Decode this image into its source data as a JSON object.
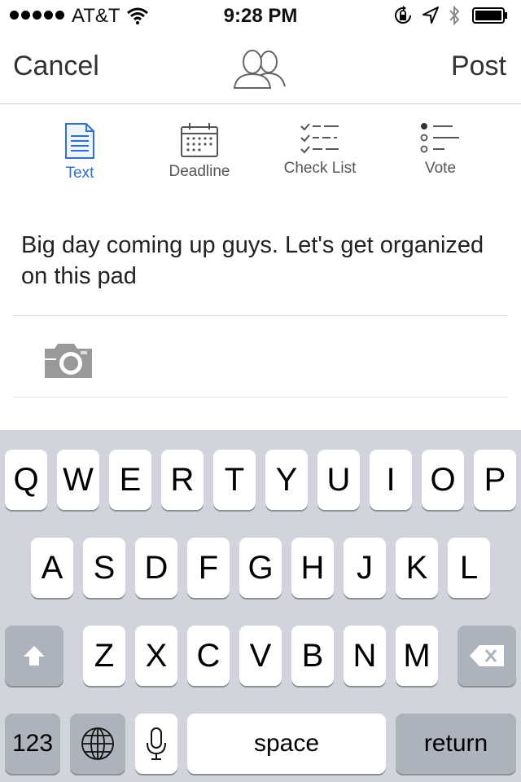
{
  "status_bar": {
    "carrier": "AT&T",
    "time": "9:28 PM",
    "signal_bars": 5,
    "icons": [
      "wifi-icon",
      "rotation-lock-icon",
      "location-arrow-icon",
      "bluetooth-icon",
      "battery-icon"
    ]
  },
  "nav": {
    "cancel_label": "Cancel",
    "center_icon": "group-icon",
    "post_label": "Post"
  },
  "tabs": [
    {
      "label": "Text",
      "icon": "document-icon",
      "active": true
    },
    {
      "label": "Deadline",
      "icon": "calendar-icon",
      "active": false
    },
    {
      "label": "Check List",
      "icon": "checklist-icon",
      "active": false
    },
    {
      "label": "Vote",
      "icon": "vote-icon",
      "active": false
    }
  ],
  "message": {
    "text": "Big day coming up guys. Let's get organized on this pad"
  },
  "attachment": {
    "icon": "camera-icon"
  },
  "keyboard": {
    "row1": [
      "Q",
      "W",
      "E",
      "R",
      "T",
      "Y",
      "U",
      "I",
      "O",
      "P"
    ],
    "row2": [
      "A",
      "S",
      "D",
      "F",
      "G",
      "H",
      "J",
      "K",
      "L"
    ],
    "row3": [
      "Z",
      "X",
      "C",
      "V",
      "B",
      "N",
      "M"
    ],
    "numbers_label": "123",
    "space_label": "space",
    "return_label": "return"
  },
  "colors": {
    "accent": "#2f6fcf",
    "keyboard_bg": "#d1d5db",
    "key_bg": "#ffffff",
    "special_key_bg": "#acb3bc"
  }
}
